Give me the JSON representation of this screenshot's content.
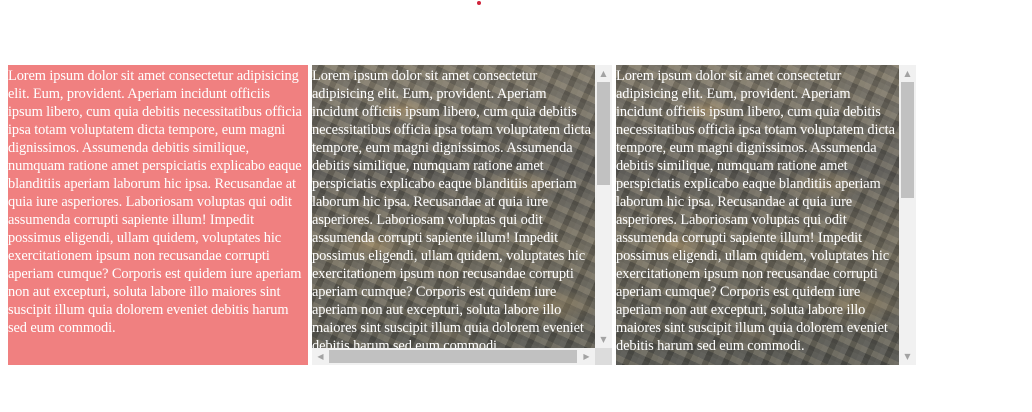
{
  "boxes": [
    {
      "id": "box1",
      "background_color": "#f08080",
      "text": "Lorem ipsum dolor sit amet consectetur adipisicing elit. Eum, provident. Aperiam incidunt officiis ipsum libero, cum quia debitis necessitatibus officia ipsa totam voluptatem dicta tempore, eum magni dignissimos. Assumenda debitis similique, numquam ratione amet perspiciatis explicabo eaque blanditiis aperiam laborum hic ipsa. Recusandae at quia iure asperiores. Laboriosam voluptas qui odit assumenda corrupti sapiente illum! Impedit possimus eligendi, ullam quidem, voluptates hic exercitationem ipsum non recusandae corrupti aperiam cumque? Corporis est quidem iure aperiam non aut excepturi, soluta labore illo maiores sint suscipit illum quia dolorem eveniet debitis harum sed eum commodi."
    },
    {
      "id": "box2",
      "background": "aerial-city-photo",
      "text": "Lorem ipsum dolor sit amet consectetur adipisicing elit. Eum, provident. Aperiam incidunt officiis ipsum libero, cum quia debitis necessitatibus officia ipsa totam voluptatem dicta tempore, eum magni dignissimos. Assumenda debitis similique, numquam ratione amet perspiciatis explicabo eaque blanditiis aperiam laborum hic ipsa. Recusandae at quia iure asperiores. Laboriosam voluptas qui odit assumenda corrupti sapiente illum! Impedit possimus eligendi, ullam quidem, voluptates hic exercitationem ipsum non recusandae corrupti aperiam cumque? Corporis est quidem iure aperiam non aut excepturi, soluta labore illo maiores sint suscipit illum quia dolorem eveniet debitis harum sed eum commodi.",
      "scrollbars": [
        "vertical",
        "horizontal"
      ]
    },
    {
      "id": "box3",
      "background": "aerial-city-photo",
      "text": "Lorem ipsum dolor sit amet consectetur adipisicing elit. Eum, provident. Aperiam incidunt officiis ipsum libero, cum quia debitis necessitatibus officia ipsa totam voluptatem dicta tempore, eum magni dignissimos. Assumenda debitis similique, numquam ratione amet perspiciatis explicabo eaque blanditiis aperiam laborum hic ipsa. Recusandae at quia iure asperiores. Laboriosam voluptas qui odit assumenda corrupti sapiente illum! Impedit possimus eligendi, ullam quidem, voluptates hic exercitationem ipsum non recusandae corrupti aperiam cumque? Corporis est quidem iure aperiam non aut excepturi, soluta labore illo maiores sint suscipit illum quia dolorem eveniet debitis harum sed eum commodi.",
      "scrollbars": [
        "vertical"
      ]
    }
  ],
  "icons": {
    "scroll_up": "▲",
    "scroll_down": "▼",
    "scroll_left": "◀",
    "scroll_right": "▶"
  },
  "colors": {
    "marker_dot": "#d0243c",
    "text": "#ffffff"
  }
}
